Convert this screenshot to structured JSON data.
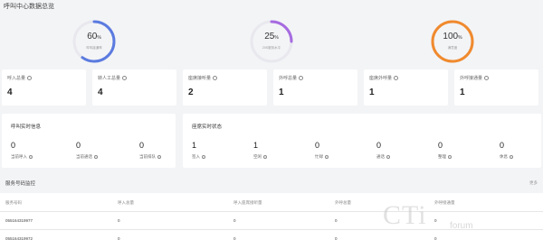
{
  "header": {
    "title": "呼叫中心数据总览"
  },
  "gauges": [
    {
      "percent_label": "60",
      "unit": "%",
      "caption": "呼叫接通率",
      "value": 0.6,
      "color": "#5b7be0"
    },
    {
      "percent_label": "25",
      "unit": "%",
      "caption": "20S服务水平",
      "value": 0.25,
      "color": "#a66be0"
    },
    {
      "percent_label": "100",
      "unit": "%",
      "caption": "满意度",
      "value": 1.0,
      "color": "#f08a2e"
    }
  ],
  "stats": [
    {
      "label": "呼入总量",
      "value": "4"
    },
    {
      "label": "转人工总量",
      "value": "4"
    },
    {
      "label": "座席接听量",
      "value": "2"
    },
    {
      "label": "外呼总量",
      "value": "1"
    },
    {
      "label": "座席外呼量",
      "value": "1"
    },
    {
      "label": "外呼接通量",
      "value": "1"
    }
  ],
  "call_info": {
    "title": "呼叫实时信息",
    "items": [
      {
        "value": "0",
        "label": "当前呼入"
      },
      {
        "value": "0",
        "label": "当前通话"
      },
      {
        "value": "0",
        "label": "当前排队"
      }
    ]
  },
  "agent_status": {
    "title": "座席实时状态",
    "items": [
      {
        "value": "1",
        "label": "签入"
      },
      {
        "value": "1",
        "label": "空闲"
      },
      {
        "value": "0",
        "label": "忙碌"
      },
      {
        "value": "0",
        "label": "通话"
      },
      {
        "value": "0",
        "label": "整理"
      },
      {
        "value": "0",
        "label": "休息"
      }
    ]
  },
  "service_monitor": {
    "title": "服务号码监控",
    "more": "更多",
    "columns": [
      "服务号码",
      "呼入总量",
      "呼入座席接听量",
      "外呼总量",
      "外呼接通量"
    ],
    "rows": [
      [
        "055164319977",
        "0",
        "0",
        "0",
        "0"
      ],
      [
        "055164319972",
        "0",
        "0",
        "0",
        "0"
      ]
    ]
  },
  "watermark": {
    "main": "CTi",
    "sub": "forum"
  }
}
